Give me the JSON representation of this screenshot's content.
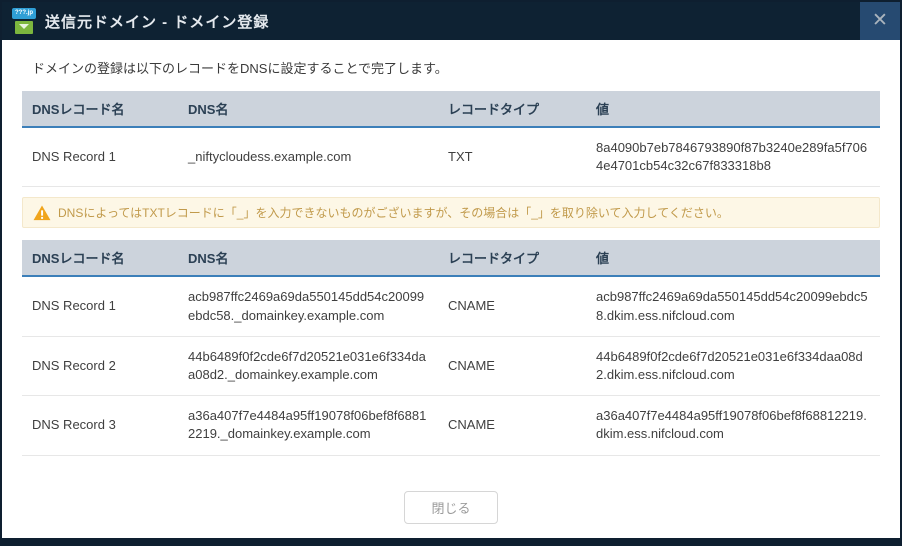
{
  "modal": {
    "title": "送信元ドメイン - ドメイン登録",
    "icon_label": "???.jp",
    "close_icon": "✕",
    "intro": "ドメインの登録は以下のレコードをDNSに設定することで完了します。",
    "warning": {
      "text": "DNSによってはTXTレコードに「_」を入力できないものがございますが、その場合は「_」を取り除いて入力してください。"
    },
    "footer": {
      "close_label": "閉じる"
    }
  },
  "txt_table": {
    "headers": [
      "DNSレコード名",
      "DNS名",
      "レコードタイプ",
      "値"
    ],
    "rows": [
      [
        "DNS Record 1",
        "_niftycloudess.example.com",
        "TXT",
        "8a4090b7eb7846793890f87b3240e289fa5f7064e4701cb54c32c67f833318b8"
      ]
    ]
  },
  "cname_table": {
    "headers": [
      "DNSレコード名",
      "DNS名",
      "レコードタイプ",
      "値"
    ],
    "rows": [
      [
        "DNS Record 1",
        "acb987ffc2469a69da550145dd54c20099ebdc58._domainkey.example.com",
        "CNAME",
        "acb987ffc2469a69da550145dd54c20099ebdc58.dkim.ess.nifcloud.com"
      ],
      [
        "DNS Record 2",
        "44b6489f0f2cde6f7d20521e031e6f334daa08d2._domainkey.example.com",
        "CNAME",
        "44b6489f0f2cde6f7d20521e031e6f334daa08d2.dkim.ess.nifcloud.com"
      ],
      [
        "DNS Record 3",
        "a36a407f7e4484a95ff19078f06bef8f68812219._domainkey.example.com",
        "CNAME",
        "a36a407f7e4484a95ff19078f06bef8f68812219.dkim.ess.nifcloud.com"
      ]
    ]
  },
  "colors": {
    "header_bg": "#0e2233",
    "close_button_bg": "#264a71",
    "table_header_bg": "#ccd3dc",
    "table_header_accent": "#3c7fb9",
    "warning_bg": "#fdf7e6",
    "warning_text": "#c19a4b",
    "warning_icon": "#f0a51d",
    "icon_blue": "#2f9fd6",
    "icon_green": "#7cb63e"
  }
}
